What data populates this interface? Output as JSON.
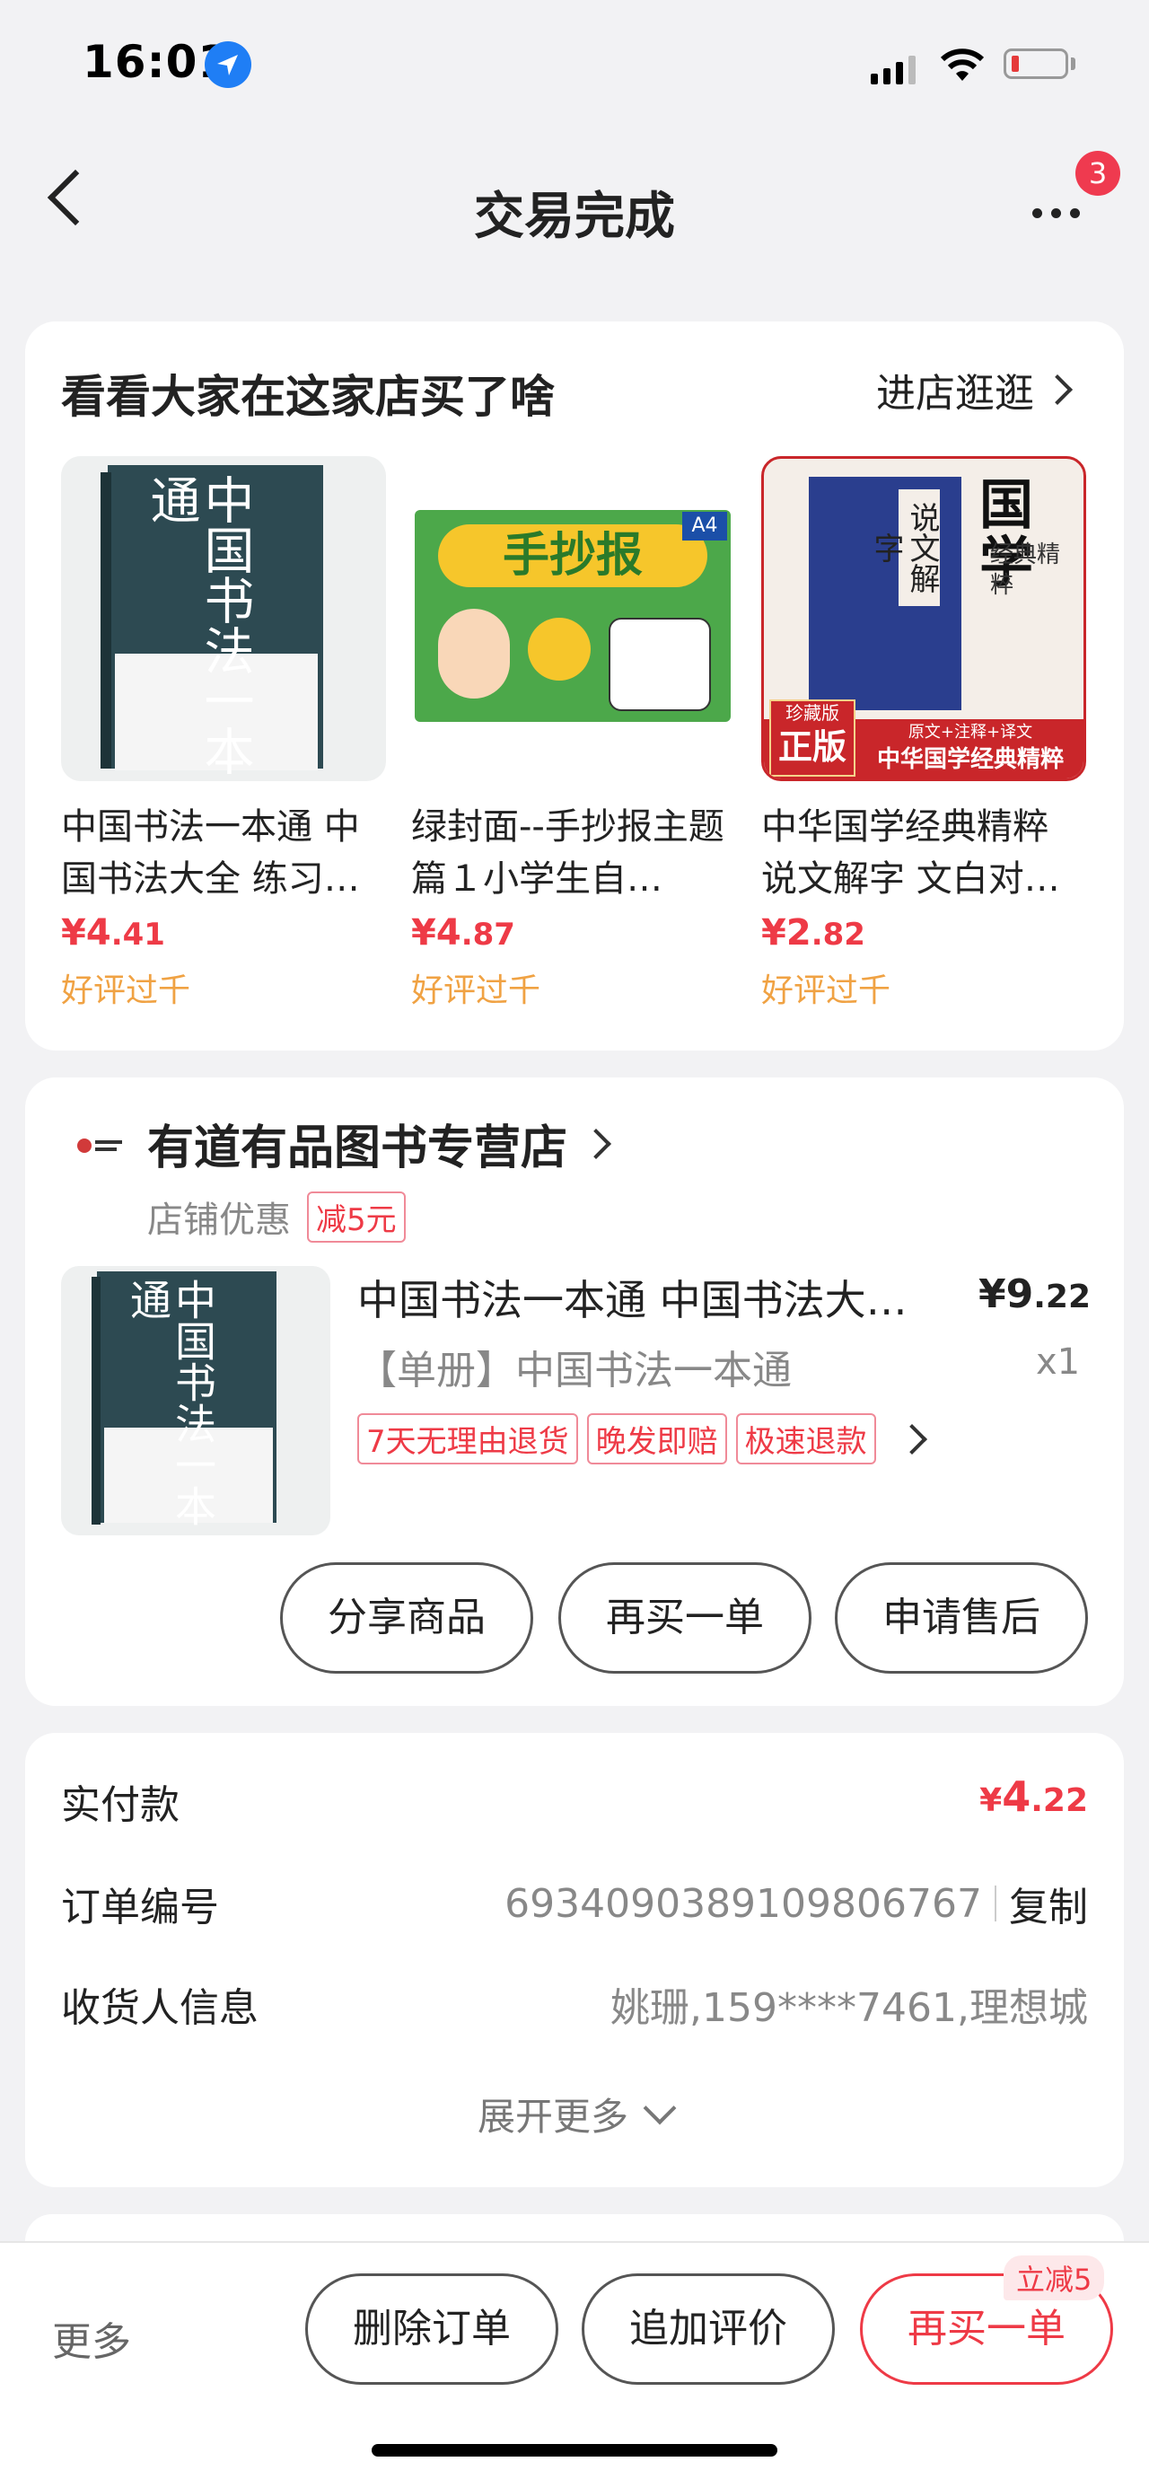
{
  "status_bar": {
    "time": "16:01"
  },
  "nav": {
    "title": "交易完成",
    "notification_count": "3"
  },
  "recommend": {
    "title": "看看大家在这家店买了啥",
    "enter_shop": "进店逛逛",
    "products": [
      {
        "name": "中国书法一本通 中国书法大全 练习…",
        "currency": "¥",
        "price_int": "4",
        "price_dec": ".41",
        "praise": "好评过千"
      },
      {
        "name": "绿封面--手抄报主题篇１小学生自…",
        "currency": "¥",
        "price_int": "4",
        "price_dec": ".87",
        "praise": "好评过千"
      },
      {
        "name": "中华国学经典精粹 说文解字 文白对…",
        "currency": "¥",
        "price_int": "2",
        "price_dec": ".82",
        "praise": "好评过千"
      }
    ],
    "cover_texts": {
      "book1_title": "中国书法一本通",
      "book2_title": "手抄报",
      "book2_a4": "A4",
      "book3_big": "国学",
      "book3_sub": "经典精粹",
      "book3_spine": "说文解字",
      "book3_badge_top": "珍藏版",
      "book3_badge": "正版",
      "book3_banner_top": "原文+注释+译文",
      "book3_banner": "中华国学经典精粹"
    }
  },
  "order": {
    "shop_name": "有道有品图书专营店",
    "shop_promo_label": "店铺优惠",
    "shop_promo_tag": "减5元",
    "item_name": "中国书法一本通 中国书法大…",
    "item_spec": "【单册】中国书法一本通",
    "item_currency": "¥",
    "item_price_int": "9",
    "item_price_dec": ".22",
    "item_qty": "x1",
    "service_tags": [
      "7天无理由退货",
      "晚发即赔",
      "极速退款"
    ],
    "buttons": {
      "share": "分享商品",
      "rebuy": "再买一单",
      "after_sale": "申请售后"
    }
  },
  "details": {
    "paid_label": "实付款",
    "paid_currency": "¥",
    "paid_int": "4",
    "paid_dec": ".22",
    "order_no_label": "订单编号",
    "order_no": "6934090389109806767",
    "copy": "复制",
    "receiver_label": "收货人信息",
    "receiver": "姚珊,159****7461,理想城",
    "expand": "展开更多"
  },
  "bottom_bar": {
    "more": "更多",
    "delete": "删除订单",
    "add_review": "追加评价",
    "rebuy": "再买一单",
    "rebuy_badge": "立减5"
  },
  "colors": {
    "accent": "#ee3a46",
    "praise": "#f0a243",
    "background": "#f2f2f4"
  }
}
